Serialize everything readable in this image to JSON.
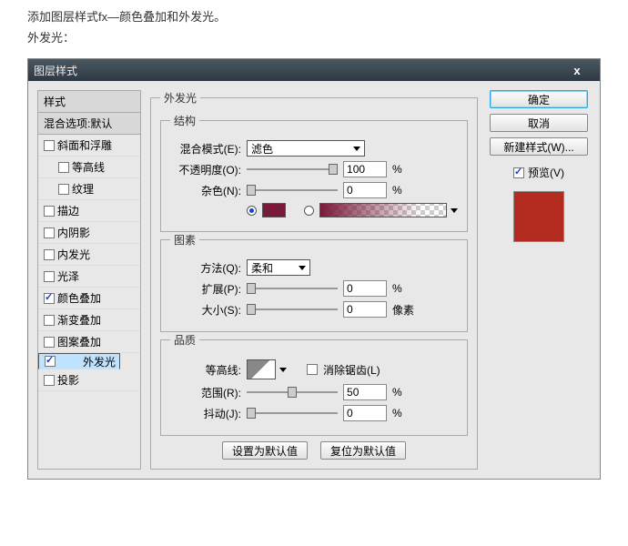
{
  "intro": {
    "line1": "添加图层样式fx—颜色叠加和外发光。",
    "line2": "外发光："
  },
  "dialog": {
    "title": "图层样式",
    "close_icon": "x"
  },
  "sidebar": {
    "header": "样式",
    "blend_header": "混合选项:默认",
    "items": [
      {
        "label": "斜面和浮雕",
        "checked": false,
        "indent": 0
      },
      {
        "label": "等高线",
        "checked": false,
        "indent": 1
      },
      {
        "label": "纹理",
        "checked": false,
        "indent": 1
      },
      {
        "label": "描边",
        "checked": false,
        "indent": 0
      },
      {
        "label": "内阴影",
        "checked": false,
        "indent": 0
      },
      {
        "label": "内发光",
        "checked": false,
        "indent": 0
      },
      {
        "label": "光泽",
        "checked": false,
        "indent": 0
      },
      {
        "label": "颜色叠加",
        "checked": true,
        "indent": 0
      },
      {
        "label": "渐变叠加",
        "checked": false,
        "indent": 0
      },
      {
        "label": "图案叠加",
        "checked": false,
        "indent": 0
      },
      {
        "label": "外发光",
        "checked": true,
        "indent": 0,
        "selected": true
      },
      {
        "label": "投影",
        "checked": false,
        "indent": 0
      }
    ]
  },
  "panel": {
    "title": "外发光",
    "structure": {
      "title": "结构",
      "blend_label": "混合模式(E):",
      "blend_value": "滤色",
      "opacity_label": "不透明度(O):",
      "opacity_value": "100",
      "opacity_unit": "%",
      "noise_label": "杂色(N):",
      "noise_value": "0",
      "noise_unit": "%"
    },
    "element": {
      "title": "图素",
      "technique_label": "方法(Q):",
      "technique_value": "柔和",
      "spread_label": "扩展(P):",
      "spread_value": "0",
      "spread_unit": "%",
      "size_label": "大小(S):",
      "size_value": "0",
      "size_unit": "像素"
    },
    "quality": {
      "title": "品质",
      "contour_label": "等高线:",
      "anti_label": "消除锯齿(L)",
      "range_label": "范围(R):",
      "range_value": "50",
      "range_unit": "%",
      "jitter_label": "抖动(J):",
      "jitter_value": "0",
      "jitter_unit": "%"
    },
    "btn_default": "设置为默认值",
    "btn_reset": "复位为默认值"
  },
  "right": {
    "ok": "确定",
    "cancel": "取消",
    "newstyle": "新建样式(W)...",
    "preview_label": "预览(V)",
    "preview_color": "#b22b1e"
  }
}
